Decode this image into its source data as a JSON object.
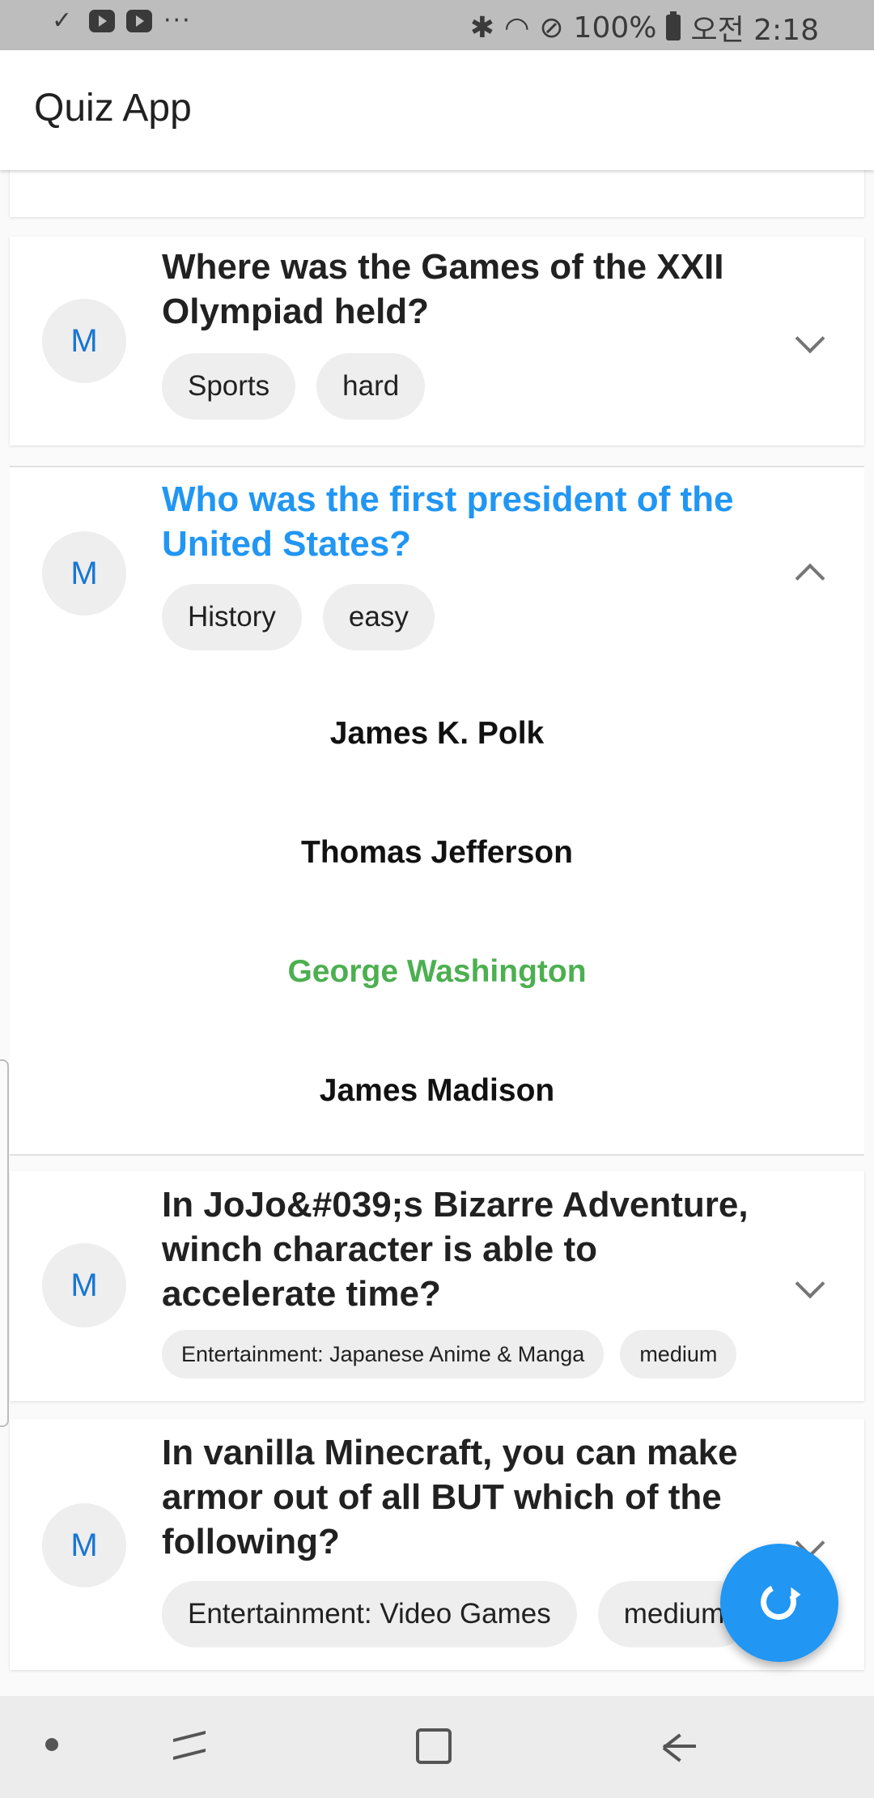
{
  "status_bar": {
    "more": "···",
    "battery": "100%",
    "time": "오전 2:18"
  },
  "app": {
    "title": "Quiz App"
  },
  "questions": [
    {
      "avatar": "M",
      "title": "Where was the Games of the XXII Olympiad held?",
      "category": "Sports",
      "difficulty": "hard",
      "expanded": false
    },
    {
      "avatar": "M",
      "title": "Who was the first president of the United States?",
      "category": "History",
      "difficulty": "easy",
      "expanded": true,
      "answers": [
        "James K. Polk",
        "Thomas Jefferson",
        "George Washington",
        "James Madison"
      ],
      "correct_answer": "George Washington"
    },
    {
      "avatar": "M",
      "title": "In JoJo&#039;s Bizarre Adventure, winch character is able to accelerate time?",
      "category": "Entertainment: Japanese Anime & Manga",
      "difficulty": "medium",
      "expanded": false
    },
    {
      "avatar": "M",
      "title": "In vanilla Minecraft, you can make armor out of all BUT which of the following?",
      "category": "Entertainment: Video Games",
      "difficulty": "medium",
      "expanded": false
    }
  ],
  "colors": {
    "accent": "#2196f3",
    "correct": "#4caf50",
    "avatar_text": "#1976d2"
  },
  "icons": {
    "fab": "refresh-icon",
    "collapsed": "chevron-down-icon",
    "expanded": "chevron-up-icon"
  }
}
